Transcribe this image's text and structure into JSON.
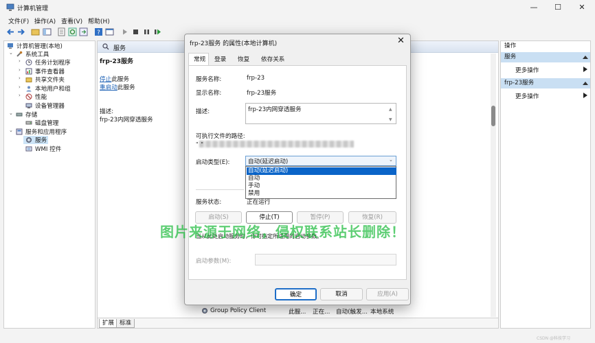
{
  "window": {
    "title": "计算机管理",
    "controls": [
      "—",
      "☐",
      "✕"
    ]
  },
  "menu": [
    "文件(F)",
    "操作(A)",
    "查看(V)",
    "帮助(H)"
  ],
  "tree": {
    "root": "计算机管理(本地)",
    "items": [
      "系统工具",
      "任务计划程序",
      "事件查看器",
      "共享文件夹",
      "本地用户和组",
      "性能",
      "设备管理器",
      "存储",
      "磁盘管理",
      "服务和应用程序",
      "服务",
      "WMI 控件"
    ]
  },
  "center": {
    "header": "服务",
    "service_name": "frp-23服务",
    "stop_link": "停止",
    "stop_suffix": "此服务",
    "restart_link": "重启动",
    "restart_suffix": "此服务",
    "desc_label": "描述:",
    "desc_value": "frp-23内网穿透服务",
    "bottom_tabs": [
      "扩展",
      "标准"
    ],
    "visible_row": {
      "name": "Group Policy Client",
      "desc": "此服...",
      "status": "正在...",
      "startup": "自动(触发...",
      "logon": "本地系统"
    }
  },
  "actions": {
    "title": "操作",
    "section1": "服务",
    "more1": "更多操作",
    "section2": "frp-23服务",
    "more2": "更多操作"
  },
  "dialog": {
    "title": "frp-23服务 的属性(本地计算机)",
    "tabs": [
      "常规",
      "登录",
      "恢复",
      "依存关系"
    ],
    "service_name_label": "服务名称:",
    "service_name_value": "frp-23",
    "display_name_label": "显示名称:",
    "display_name_value": "frp-23服务",
    "description_label": "描述:",
    "description_value": "frp-23内网穿透服务",
    "path_label": "可执行文件的路径:",
    "path_value": "\"                                                                              \"",
    "startup_type_label": "启动类型(E):",
    "startup_type_value": "自动(延迟启动)",
    "startup_options": [
      "自动(延迟启动)",
      "自动",
      "手动",
      "禁用"
    ],
    "status_label": "服务状态:",
    "status_value": "正在运行",
    "btn_start": "启动(S)",
    "btn_stop": "停止(T)",
    "btn_pause": "暂停(P)",
    "btn_resume": "恢复(R)",
    "hint": "当从此处启动服务时，你可指定所适用的启动参数。",
    "param_label": "启动参数(M):",
    "btn_ok": "确定",
    "btn_cancel": "取消",
    "btn_apply": "应用(A)"
  },
  "overlay": {
    "watermark": "图片来源于网络，侵权联系站长删除！",
    "csdn": "CSDN @科技学习"
  },
  "colors": {
    "selection": "#0a64c8",
    "action_header": "#c9dff3",
    "watermark": "#28be46"
  }
}
